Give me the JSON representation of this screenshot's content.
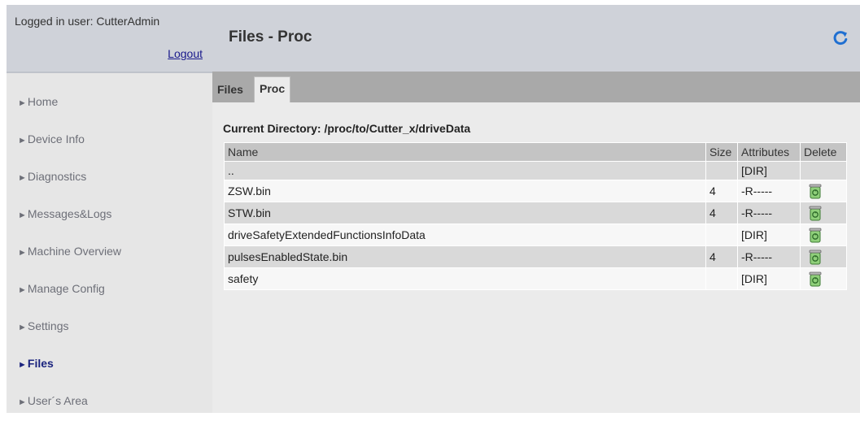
{
  "login": {
    "user_text": "Logged in user: CutterAdmin",
    "logout_label": "Logout"
  },
  "header": {
    "title": "Files - Proc",
    "refresh_icon": "refresh-icon"
  },
  "nav": {
    "arrow": "►",
    "items": [
      {
        "label": "Home",
        "active": false
      },
      {
        "label": "Device Info",
        "active": false
      },
      {
        "label": "Diagnostics",
        "active": false
      },
      {
        "label": "Messages&Logs",
        "active": false
      },
      {
        "label": "Machine Overview",
        "active": false
      },
      {
        "label": "Manage Config",
        "active": false
      },
      {
        "label": "Settings",
        "active": false
      },
      {
        "label": "Files",
        "active": true
      },
      {
        "label": "User´s Area",
        "active": false
      }
    ]
  },
  "tabs": [
    {
      "label": "Files",
      "active": false
    },
    {
      "label": "Proc",
      "active": true
    }
  ],
  "current_directory": "Current Directory: /proc/to/Cutter_x/driveData",
  "table": {
    "headers": {
      "name": "Name",
      "size": "Size",
      "attributes": "Attributes",
      "delete": "Delete"
    },
    "rows": [
      {
        "name": "..",
        "size": "",
        "attributes": "[DIR]",
        "deletable": false
      },
      {
        "name": "ZSW.bin",
        "size": "4",
        "attributes": "-R-----",
        "deletable": true
      },
      {
        "name": "STW.bin",
        "size": "4",
        "attributes": "-R-----",
        "deletable": true
      },
      {
        "name": "driveSafetyExtendedFunctionsInfoData",
        "size": "",
        "attributes": "[DIR]",
        "deletable": true
      },
      {
        "name": "pulsesEnabledState.bin",
        "size": "4",
        "attributes": "-R-----",
        "deletable": true
      },
      {
        "name": "safety",
        "size": "",
        "attributes": "[DIR]",
        "deletable": true
      }
    ],
    "delete_icon": "trash-icon"
  },
  "colors": {
    "header_bg": "#cfd2d9",
    "sidebar_bg": "#e6e6e6",
    "active_nav": "#1a237e",
    "refresh_blue": "#1f6fd1",
    "trash_green": "#4caf50"
  }
}
